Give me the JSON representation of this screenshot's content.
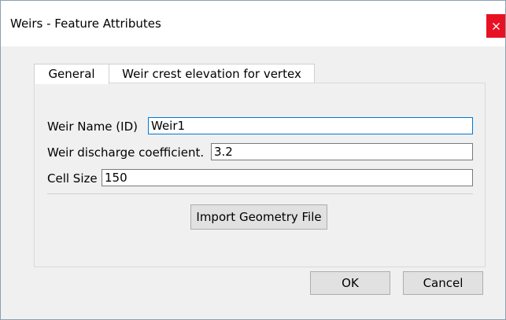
{
  "window": {
    "title": "Weirs - Feature Attributes",
    "close_icon": "close-icon",
    "close_color": "#e81123"
  },
  "tabs": [
    {
      "label": "General",
      "selected": true
    },
    {
      "label": "Weir crest elevation for vertex",
      "selected": false
    }
  ],
  "form": {
    "weir_name_label": "Weir Name (ID)",
    "weir_name_value": "Weir1",
    "discharge_label": "Weir discharge coefficient.",
    "discharge_value": "3.2",
    "cell_size_label": "Cell Size",
    "cell_size_value": "150"
  },
  "buttons": {
    "import_label": "Import Geometry File",
    "ok_label": "OK",
    "cancel_label": "Cancel"
  },
  "colors": {
    "focus_border": "#0078d7",
    "button_face": "#e1e1e1"
  }
}
